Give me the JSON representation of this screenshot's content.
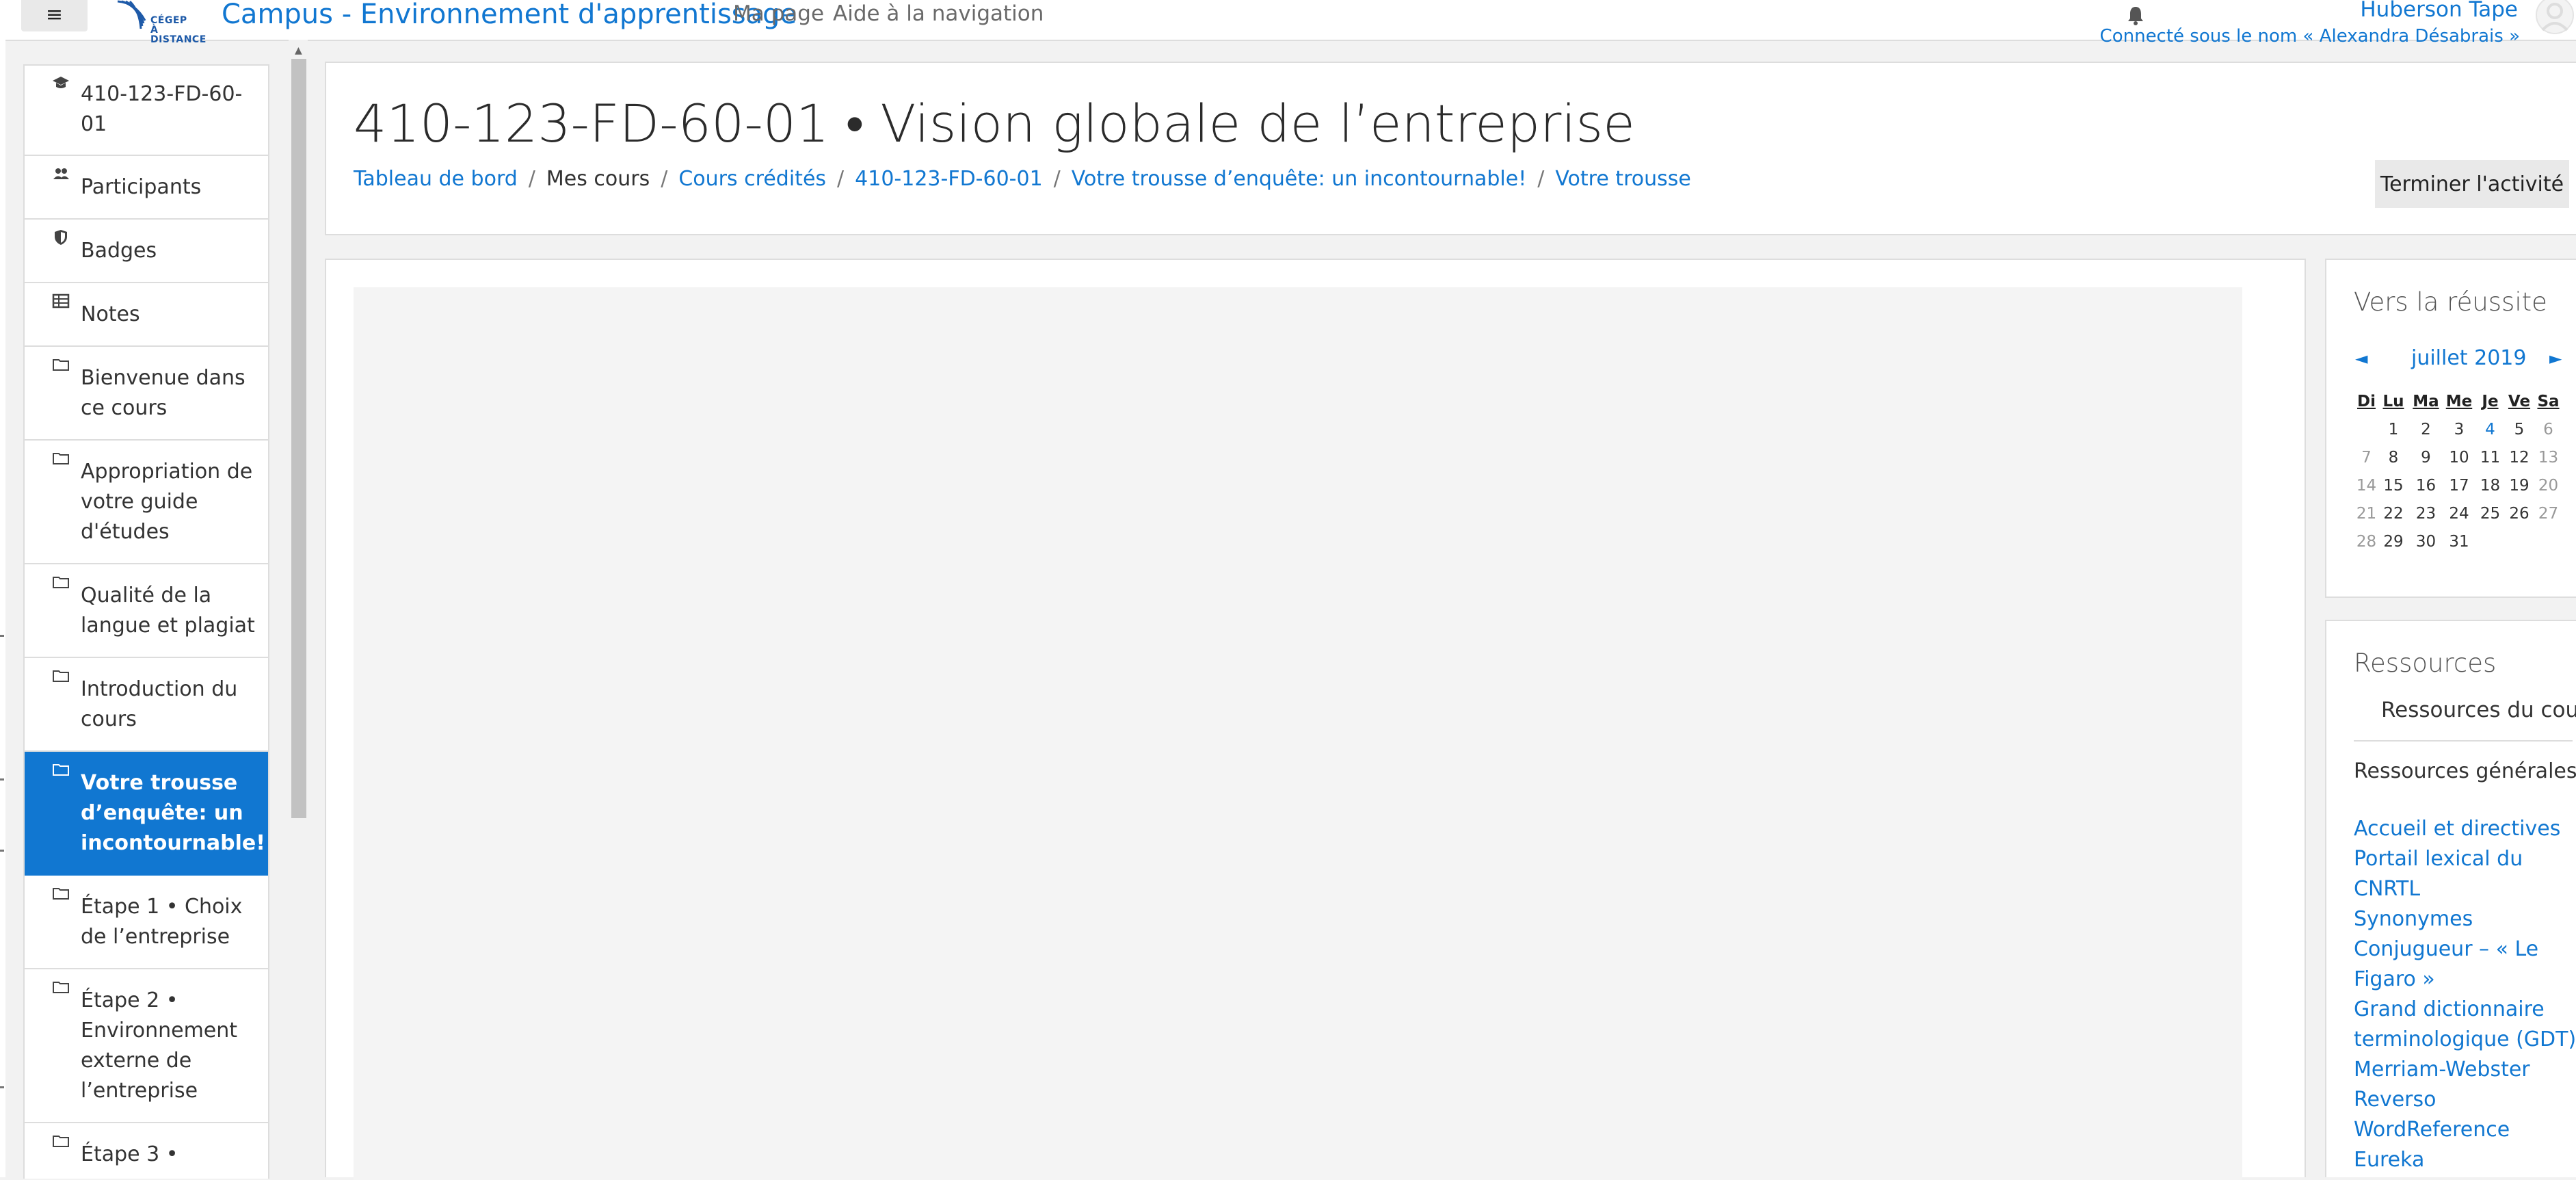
{
  "topbar": {
    "menu_glyph": "≡",
    "logo_text_line1": "CÉGEP",
    "logo_text_line2": "À DISTANCE",
    "site_title": "Campus - Environnement d'apprentissage",
    "nav_links": [
      "Ma page",
      "Aide à la navigation"
    ],
    "user_name": "Huberson Tape",
    "logged_in_as": "Connecté sous le nom « Alexandra Désabrais »",
    "icons": {
      "menu": "hamburger-icon",
      "notifications": "bell-icon",
      "user": "user-avatar-icon"
    }
  },
  "drawer": {
    "items": [
      {
        "label": "410-123-FD-60-01",
        "icon": "graduation-cap-icon",
        "active": false
      },
      {
        "label": "Participants",
        "icon": "users-icon",
        "active": false
      },
      {
        "label": "Badges",
        "icon": "shield-icon",
        "active": false
      },
      {
        "label": "Notes",
        "icon": "table-icon",
        "active": false
      },
      {
        "label": "Bienvenue dans ce cours",
        "icon": "folder-icon",
        "active": false
      },
      {
        "label": "Appropriation de votre guide d'études",
        "icon": "folder-icon",
        "active": false
      },
      {
        "label": "Qualité de la langue et plagiat",
        "icon": "folder-icon",
        "active": false
      },
      {
        "label": "Introduction du cours",
        "icon": "folder-icon",
        "active": false
      },
      {
        "label": "Votre trousse d’enquête: un incontournable!",
        "icon": "folder-icon",
        "active": true
      },
      {
        "label": "Étape 1 • Choix de l’entreprise",
        "icon": "folder-icon",
        "active": false
      },
      {
        "label": "Étape 2 • Environnement externe de l’entreprise",
        "icon": "folder-icon",
        "active": false
      },
      {
        "label": "Étape 3 •",
        "icon": "folder-icon",
        "active": false
      }
    ]
  },
  "header": {
    "title": "410-123-FD-60-01 • Vision globale de l’entreprise",
    "breadcrumb": [
      {
        "label": "Tableau de bord",
        "link": true
      },
      {
        "label": "Mes cours",
        "link": false
      },
      {
        "label": "Cours crédités",
        "link": true
      },
      {
        "label": "410-123-FD-60-01",
        "link": true
      },
      {
        "label": "Votre trousse d’enquête: un incontournable!",
        "link": true
      },
      {
        "label": "Votre trousse",
        "link": true
      }
    ],
    "breadcrumb_separator": "/",
    "finish_button": "Terminer l'activité"
  },
  "calendar": {
    "block_title": "Vers la réussite",
    "month": "juillet 2019",
    "prev": "◄",
    "next": "►",
    "weekdays": [
      "Di",
      "Lu",
      "Ma",
      "Me",
      "Je",
      "Ve",
      "Sa"
    ],
    "weeks": [
      [
        "",
        "1",
        "2",
        "3",
        "4",
        "5",
        "6"
      ],
      [
        "7",
        "8",
        "9",
        "10",
        "11",
        "12",
        "13"
      ],
      [
        "14",
        "15",
        "16",
        "17",
        "18",
        "19",
        "20"
      ],
      [
        "21",
        "22",
        "23",
        "24",
        "25",
        "26",
        "27"
      ],
      [
        "28",
        "29",
        "30",
        "31",
        "",
        "",
        ""
      ]
    ],
    "linked_days": [
      "4"
    ]
  },
  "resources": {
    "block_title": "Ressources",
    "course_resources": "Ressources du cours",
    "general_heading": "Ressources générales",
    "links": [
      "Accueil et directives",
      "Portail lexical du CNRTL",
      "Synonymes",
      "Conjugueur – « Le Figaro »",
      "Grand dictionnaire terminologique (GDT)",
      "Merriam-Webster",
      "Reverso",
      "WordReference",
      "Eureka"
    ]
  },
  "colors": {
    "accent": "#1177d1",
    "active_bg": "#1177d1",
    "page_bg": "#f2f2f2"
  }
}
